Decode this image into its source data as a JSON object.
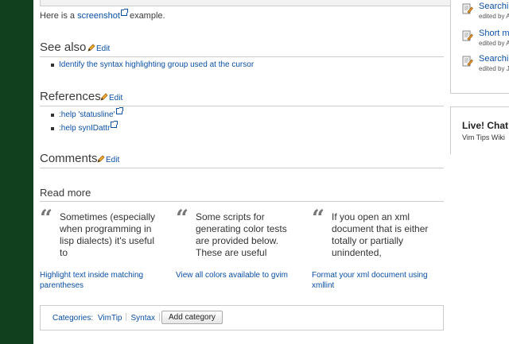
{
  "intro": {
    "prefix": "Here is a ",
    "link": "screenshot",
    "suffix": " example."
  },
  "sections": {
    "see_also": {
      "title": "See also",
      "edit": "Edit",
      "items": [
        "Identify the syntax highlighting group used at the cursor"
      ]
    },
    "references": {
      "title": "References",
      "edit": "Edit",
      "items": [
        ":help 'statusline'",
        ":help synIDattr"
      ]
    },
    "comments": {
      "title": "Comments",
      "edit": "Edit"
    },
    "read_more": {
      "title": "Read more"
    }
  },
  "read_more": [
    {
      "excerpt": "Sometimes (especially when programming in lisp dialects) it's useful to",
      "link": "Highlight text inside matching parentheses"
    },
    {
      "excerpt": "Some scripts for generating color tests are provided below. These are useful",
      "link": "View all colors available to gvim"
    },
    {
      "excerpt": "If you open an xml document that is either totally or partially unindented,",
      "link": "Format your xml document using xmllint"
    }
  ],
  "categories": {
    "label": "Categories:",
    "items": [
      "VimTip",
      "Syntax"
    ],
    "add_button": "Add category"
  },
  "sidebar": {
    "recent": [
      {
        "title": "Searchin",
        "meta": "edited by A"
      },
      {
        "title": "Short m",
        "meta": "edited by A"
      },
      {
        "title": "Searchin",
        "meta": "edited by J"
      }
    ],
    "chat": {
      "title": "Live! Chat",
      "subtitle": "Vim Tips Wiki"
    }
  },
  "colors": {
    "stripe": "#11401f",
    "link": "#0b4fa3",
    "border": "#cccccc"
  }
}
